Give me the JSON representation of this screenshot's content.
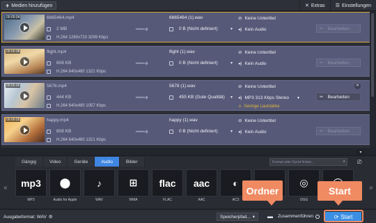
{
  "header": {
    "add_media": "Medien hinzufügen",
    "extras": "Extras",
    "settings": "Einstellungen"
  },
  "files": [
    {
      "timecode": "00:00:04",
      "name": "6665464.mp4",
      "size": "2 MB",
      "info": "H.264 1280x720 3299 Kbps",
      "out_name": "6665464 (1).wav",
      "out_quality": "0 B (Nicht definiert)",
      "subtitle": "Keine Untertitel",
      "audio": "Kein Audio",
      "warning": "",
      "edit": "Bearbeiten"
    },
    {
      "timecode": "00:00:08",
      "name": "flight.mp4",
      "size": "808 KB",
      "info": "H.264 640x480 1321 Kbps",
      "out_name": "flight (1).wav",
      "out_quality": "0 B (Nicht definiert)",
      "subtitle": "Keine Untertitel",
      "audio": "Kein Audio",
      "warning": "",
      "edit": "Bearbeiten"
    },
    {
      "timecode": "00:00:06",
      "name": "5678.mp4",
      "size": "444 KB",
      "info": "H.264 640x480 1057 Kbps",
      "out_name": "5678 (1).wav",
      "out_quality": "455 KB (Gute Qualität)",
      "subtitle": "Keine Untertitel",
      "audio": "MP3 313 Kbps Stereo",
      "warning": "Geringe Lautstärke",
      "edit": "Bearbeiten"
    },
    {
      "timecode": "00:00:05",
      "name": "happy.mp4",
      "size": "808 KB",
      "info": "H.264 640x480 1321 Kbps",
      "out_name": "happy (1).wav",
      "out_quality": "0 B (Nicht definiert)",
      "subtitle": "Keine Untertitel",
      "audio": "Kein Audio",
      "warning": "",
      "edit": "Bearbeiten"
    }
  ],
  "format_tabs": [
    "Gängig",
    "Video",
    "Geräte",
    "Audio",
    "Bilder"
  ],
  "search_placeholder": "Format oder Gerät finden...",
  "format_tiles": [
    {
      "logo": "mp3",
      "label": "MP3"
    },
    {
      "logo": "",
      "label": "Audio for Apple"
    },
    {
      "logo": "♪",
      "label": "WAV"
    },
    {
      "logo": "⊞",
      "label": "WMA"
    },
    {
      "logo": "flac",
      "label": "FLAC"
    },
    {
      "logo": "aac",
      "label": "AAC"
    },
    {
      "logo": "",
      "label": "AC3"
    },
    {
      "logo": "",
      "label": ""
    },
    {
      "logo": "",
      "label": "OGG"
    },
    {
      "logo": "",
      "label": ""
    }
  ],
  "footer": {
    "output_format": "Ausgabeformat: WAV",
    "save": "Speicherpfad...",
    "merge": "Zusammenführen",
    "start": "Start"
  },
  "callouts": {
    "ordner": "Ordner",
    "start": "Start"
  }
}
